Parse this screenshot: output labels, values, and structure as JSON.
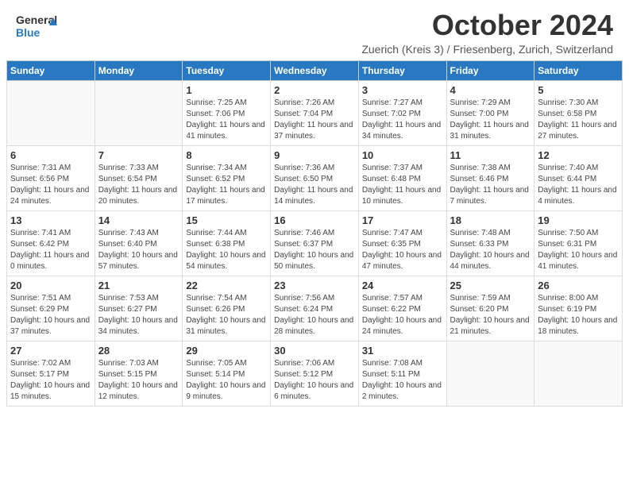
{
  "header": {
    "logo_general": "General",
    "logo_blue": "Blue",
    "month_title": "October 2024",
    "subtitle": "Zuerich (Kreis 3) / Friesenberg, Zurich, Switzerland"
  },
  "days_of_week": [
    "Sunday",
    "Monday",
    "Tuesday",
    "Wednesday",
    "Thursday",
    "Friday",
    "Saturday"
  ],
  "weeks": [
    [
      {
        "day": "",
        "sunrise": "",
        "sunset": "",
        "daylight": "",
        "empty": true
      },
      {
        "day": "",
        "sunrise": "",
        "sunset": "",
        "daylight": "",
        "empty": true
      },
      {
        "day": "1",
        "sunrise": "Sunrise: 7:25 AM",
        "sunset": "Sunset: 7:06 PM",
        "daylight": "Daylight: 11 hours and 41 minutes."
      },
      {
        "day": "2",
        "sunrise": "Sunrise: 7:26 AM",
        "sunset": "Sunset: 7:04 PM",
        "daylight": "Daylight: 11 hours and 37 minutes."
      },
      {
        "day": "3",
        "sunrise": "Sunrise: 7:27 AM",
        "sunset": "Sunset: 7:02 PM",
        "daylight": "Daylight: 11 hours and 34 minutes."
      },
      {
        "day": "4",
        "sunrise": "Sunrise: 7:29 AM",
        "sunset": "Sunset: 7:00 PM",
        "daylight": "Daylight: 11 hours and 31 minutes."
      },
      {
        "day": "5",
        "sunrise": "Sunrise: 7:30 AM",
        "sunset": "Sunset: 6:58 PM",
        "daylight": "Daylight: 11 hours and 27 minutes."
      }
    ],
    [
      {
        "day": "6",
        "sunrise": "Sunrise: 7:31 AM",
        "sunset": "Sunset: 6:56 PM",
        "daylight": "Daylight: 11 hours and 24 minutes."
      },
      {
        "day": "7",
        "sunrise": "Sunrise: 7:33 AM",
        "sunset": "Sunset: 6:54 PM",
        "daylight": "Daylight: 11 hours and 20 minutes."
      },
      {
        "day": "8",
        "sunrise": "Sunrise: 7:34 AM",
        "sunset": "Sunset: 6:52 PM",
        "daylight": "Daylight: 11 hours and 17 minutes."
      },
      {
        "day": "9",
        "sunrise": "Sunrise: 7:36 AM",
        "sunset": "Sunset: 6:50 PM",
        "daylight": "Daylight: 11 hours and 14 minutes."
      },
      {
        "day": "10",
        "sunrise": "Sunrise: 7:37 AM",
        "sunset": "Sunset: 6:48 PM",
        "daylight": "Daylight: 11 hours and 10 minutes."
      },
      {
        "day": "11",
        "sunrise": "Sunrise: 7:38 AM",
        "sunset": "Sunset: 6:46 PM",
        "daylight": "Daylight: 11 hours and 7 minutes."
      },
      {
        "day": "12",
        "sunrise": "Sunrise: 7:40 AM",
        "sunset": "Sunset: 6:44 PM",
        "daylight": "Daylight: 11 hours and 4 minutes."
      }
    ],
    [
      {
        "day": "13",
        "sunrise": "Sunrise: 7:41 AM",
        "sunset": "Sunset: 6:42 PM",
        "daylight": "Daylight: 11 hours and 0 minutes."
      },
      {
        "day": "14",
        "sunrise": "Sunrise: 7:43 AM",
        "sunset": "Sunset: 6:40 PM",
        "daylight": "Daylight: 10 hours and 57 minutes."
      },
      {
        "day": "15",
        "sunrise": "Sunrise: 7:44 AM",
        "sunset": "Sunset: 6:38 PM",
        "daylight": "Daylight: 10 hours and 54 minutes."
      },
      {
        "day": "16",
        "sunrise": "Sunrise: 7:46 AM",
        "sunset": "Sunset: 6:37 PM",
        "daylight": "Daylight: 10 hours and 50 minutes."
      },
      {
        "day": "17",
        "sunrise": "Sunrise: 7:47 AM",
        "sunset": "Sunset: 6:35 PM",
        "daylight": "Daylight: 10 hours and 47 minutes."
      },
      {
        "day": "18",
        "sunrise": "Sunrise: 7:48 AM",
        "sunset": "Sunset: 6:33 PM",
        "daylight": "Daylight: 10 hours and 44 minutes."
      },
      {
        "day": "19",
        "sunrise": "Sunrise: 7:50 AM",
        "sunset": "Sunset: 6:31 PM",
        "daylight": "Daylight: 10 hours and 41 minutes."
      }
    ],
    [
      {
        "day": "20",
        "sunrise": "Sunrise: 7:51 AM",
        "sunset": "Sunset: 6:29 PM",
        "daylight": "Daylight: 10 hours and 37 minutes."
      },
      {
        "day": "21",
        "sunrise": "Sunrise: 7:53 AM",
        "sunset": "Sunset: 6:27 PM",
        "daylight": "Daylight: 10 hours and 34 minutes."
      },
      {
        "day": "22",
        "sunrise": "Sunrise: 7:54 AM",
        "sunset": "Sunset: 6:26 PM",
        "daylight": "Daylight: 10 hours and 31 minutes."
      },
      {
        "day": "23",
        "sunrise": "Sunrise: 7:56 AM",
        "sunset": "Sunset: 6:24 PM",
        "daylight": "Daylight: 10 hours and 28 minutes."
      },
      {
        "day": "24",
        "sunrise": "Sunrise: 7:57 AM",
        "sunset": "Sunset: 6:22 PM",
        "daylight": "Daylight: 10 hours and 24 minutes."
      },
      {
        "day": "25",
        "sunrise": "Sunrise: 7:59 AM",
        "sunset": "Sunset: 6:20 PM",
        "daylight": "Daylight: 10 hours and 21 minutes."
      },
      {
        "day": "26",
        "sunrise": "Sunrise: 8:00 AM",
        "sunset": "Sunset: 6:19 PM",
        "daylight": "Daylight: 10 hours and 18 minutes."
      }
    ],
    [
      {
        "day": "27",
        "sunrise": "Sunrise: 7:02 AM",
        "sunset": "Sunset: 5:17 PM",
        "daylight": "Daylight: 10 hours and 15 minutes."
      },
      {
        "day": "28",
        "sunrise": "Sunrise: 7:03 AM",
        "sunset": "Sunset: 5:15 PM",
        "daylight": "Daylight: 10 hours and 12 minutes."
      },
      {
        "day": "29",
        "sunrise": "Sunrise: 7:05 AM",
        "sunset": "Sunset: 5:14 PM",
        "daylight": "Daylight: 10 hours and 9 minutes."
      },
      {
        "day": "30",
        "sunrise": "Sunrise: 7:06 AM",
        "sunset": "Sunset: 5:12 PM",
        "daylight": "Daylight: 10 hours and 6 minutes."
      },
      {
        "day": "31",
        "sunrise": "Sunrise: 7:08 AM",
        "sunset": "Sunset: 5:11 PM",
        "daylight": "Daylight: 10 hours and 2 minutes."
      },
      {
        "day": "",
        "sunrise": "",
        "sunset": "",
        "daylight": "",
        "empty": true
      },
      {
        "day": "",
        "sunrise": "",
        "sunset": "",
        "daylight": "",
        "empty": true
      }
    ]
  ]
}
